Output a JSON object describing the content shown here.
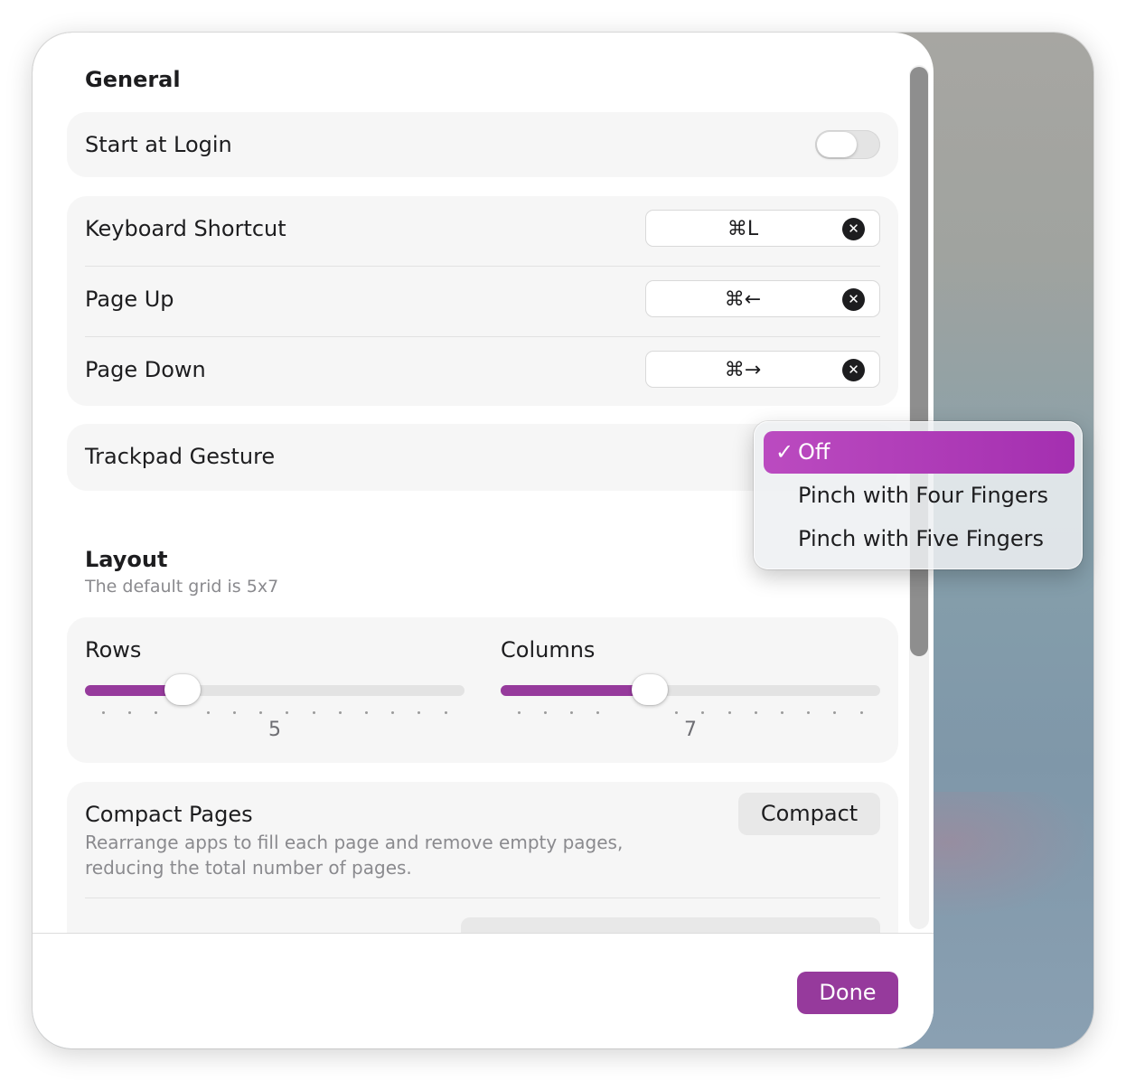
{
  "general": {
    "title": "General",
    "start_at_login": {
      "label": "Start at Login",
      "enabled": false
    },
    "shortcuts": [
      {
        "label": "Keyboard Shortcut",
        "keys": "⌘L",
        "clear_icon": "x-circle-icon"
      },
      {
        "label": "Page Up",
        "keys": "⌘←",
        "clear_icon": "x-circle-icon"
      },
      {
        "label": "Page Down",
        "keys": "⌘→",
        "clear_icon": "x-circle-icon"
      }
    ],
    "trackpad_gesture": {
      "label": "Trackpad Gesture",
      "options": [
        "Off",
        "Pinch with Four Fingers",
        "Pinch with Five Fingers"
      ],
      "selected": "Off",
      "check": "✓"
    }
  },
  "layout": {
    "title": "Layout",
    "subtitle": "The default grid is 5x7",
    "rows": {
      "label": "Rows",
      "value": "5"
    },
    "columns": {
      "label": "Columns",
      "value": "7"
    },
    "compact": {
      "title": "Compact Pages",
      "description": "Rearrange apps to fill each page and remove empty pages, reducing the total number of pages.",
      "button": "Compact"
    }
  },
  "footer": {
    "done_label": "Done"
  },
  "colors": {
    "accent": "#963a9c",
    "menu_highlight": "#b040b8"
  }
}
